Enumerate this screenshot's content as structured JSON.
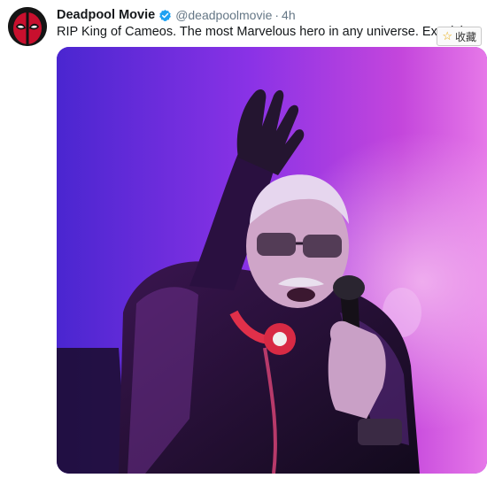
{
  "tweet": {
    "display_name": "Deadpool Movie",
    "handle": "@deadpoolmovie",
    "separator": "·",
    "time": "4h",
    "text": "RIP King of Cameos. The most Marvelous hero in any universe. Excelsior.",
    "verified_icon": "verified-badge-icon",
    "avatar_icon": "deadpool-mask-icon"
  },
  "collect_button": {
    "label": "收藏",
    "icon": "star-icon"
  },
  "colors": {
    "name": "#14171a",
    "meta": "#657786",
    "verified": "#1da1f2",
    "media_bg_left": "#5a2ad8",
    "media_bg_right": "#d64bd8"
  }
}
